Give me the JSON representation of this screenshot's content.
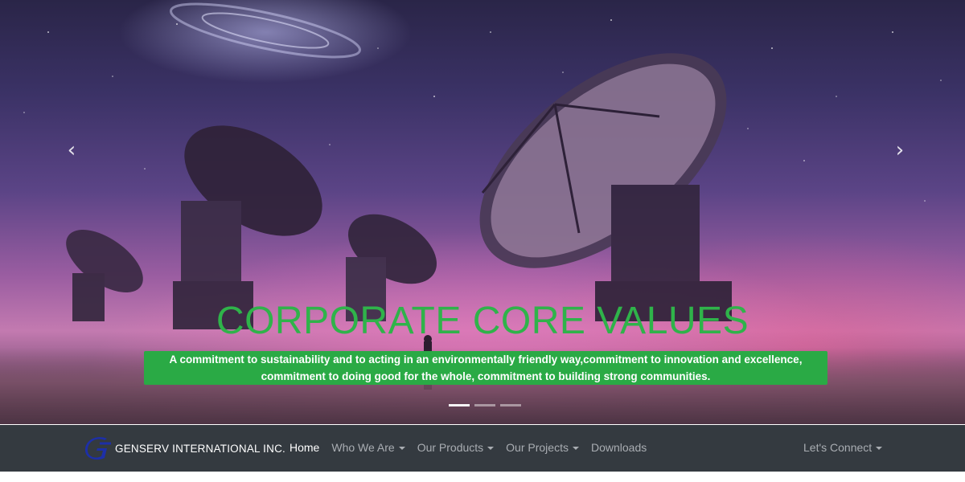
{
  "carousel": {
    "prev_icon": "chevron-left-icon",
    "next_icon": "chevron-right-icon",
    "prev_glyph": "‹",
    "next_glyph": "›",
    "title": "CORPORATE CORE VALUES",
    "text": "A commitment to sustainability and to acting in an environmentally friendly way,commitment to innovation and excellence, commitment to doing good for the whole, commitment to building strong communities.",
    "slides_count": 3,
    "active_slide": 1,
    "title_color": "#2fb34a",
    "text_bg_color": "#2aaa45"
  },
  "navbar": {
    "brand_name": "GENSERV INTERNATIONAL INC.",
    "logo_icon": "genserv-logo-icon",
    "items": [
      {
        "label": "Home",
        "active": true,
        "dropdown": false
      },
      {
        "label": "Who We Are",
        "active": false,
        "dropdown": true
      },
      {
        "label": "Our Products",
        "active": false,
        "dropdown": true
      },
      {
        "label": "Our Projects",
        "active": false,
        "dropdown": true
      },
      {
        "label": "Downloads",
        "active": false,
        "dropdown": false
      }
    ],
    "connect_label": "Let's Connect",
    "background_color": "#343a40"
  }
}
